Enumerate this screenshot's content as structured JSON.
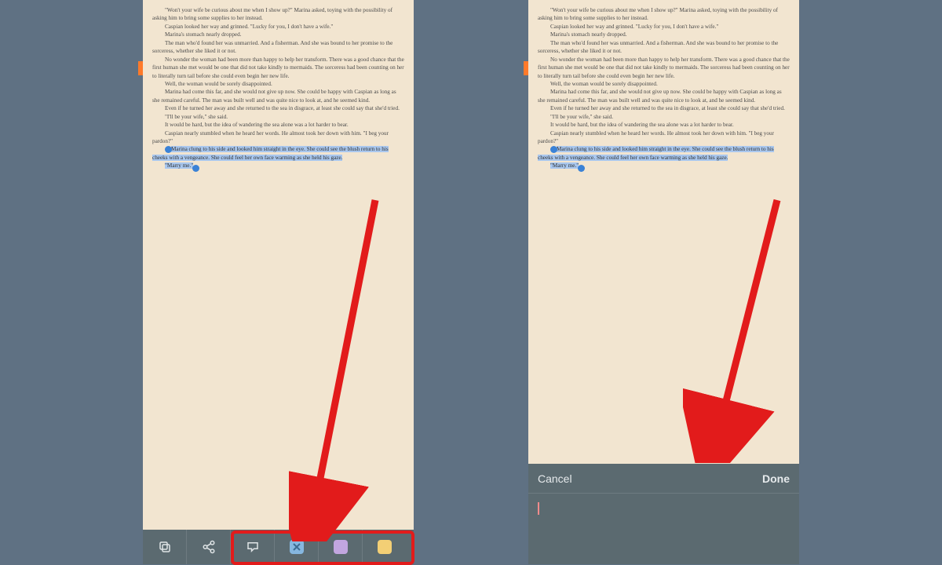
{
  "book": {
    "paragraphs": [
      "\"Won't your wife be curious about me when I show up?\" Marina asked, toying with the possibility of asking him to bring some supplies to her instead.",
      "Caspian looked her way and grinned. \"Lucky for you, I don't have a wife.\"",
      "Marina's stomach nearly dropped.",
      "The man who'd found her was unmarried. And a fisherman. And she was bound to her promise to the sorceress, whether she liked it or not.",
      "No wonder the woman had been more than happy to help her transform. There was a good chance that the first human she met would be one that did not take kindly to mermaids. The sorceress had been counting on her to literally turn tail before she could even begin her new life.",
      "Well, the woman would be sorely disappointed.",
      "Marina had come this far, and she would not give up now. She could be happy with Caspian as long as she remained careful. The man was built well and was quite nice to look at, and he seemed kind.",
      "Even if he turned her away and she returned to the sea in disgrace, at least she could say that she'd tried.",
      "\"I'll be your wife,\" she said.",
      "It would be hard, but the idea of wandering the sea alone was a lot harder to bear.",
      "Caspian nearly stumbled when he heard her words. He almost took her down with him. \"I beg your pardon?\""
    ],
    "highlighted": [
      "Marina clung to his side and looked him straight in the eye. She could see the blush return to his cheeks with a vengeance. She could feel her own face warming as she held his gaze.",
      "\"Marry me.\""
    ]
  },
  "toolbar": {
    "copy_icon": "copy",
    "share_icon": "share",
    "note_icon": "note",
    "colors": {
      "blue": "#86b7e0",
      "purple": "#c2a6e0",
      "yellow": "#f3cf75"
    }
  },
  "note_panel": {
    "cancel": "Cancel",
    "done": "Done"
  }
}
